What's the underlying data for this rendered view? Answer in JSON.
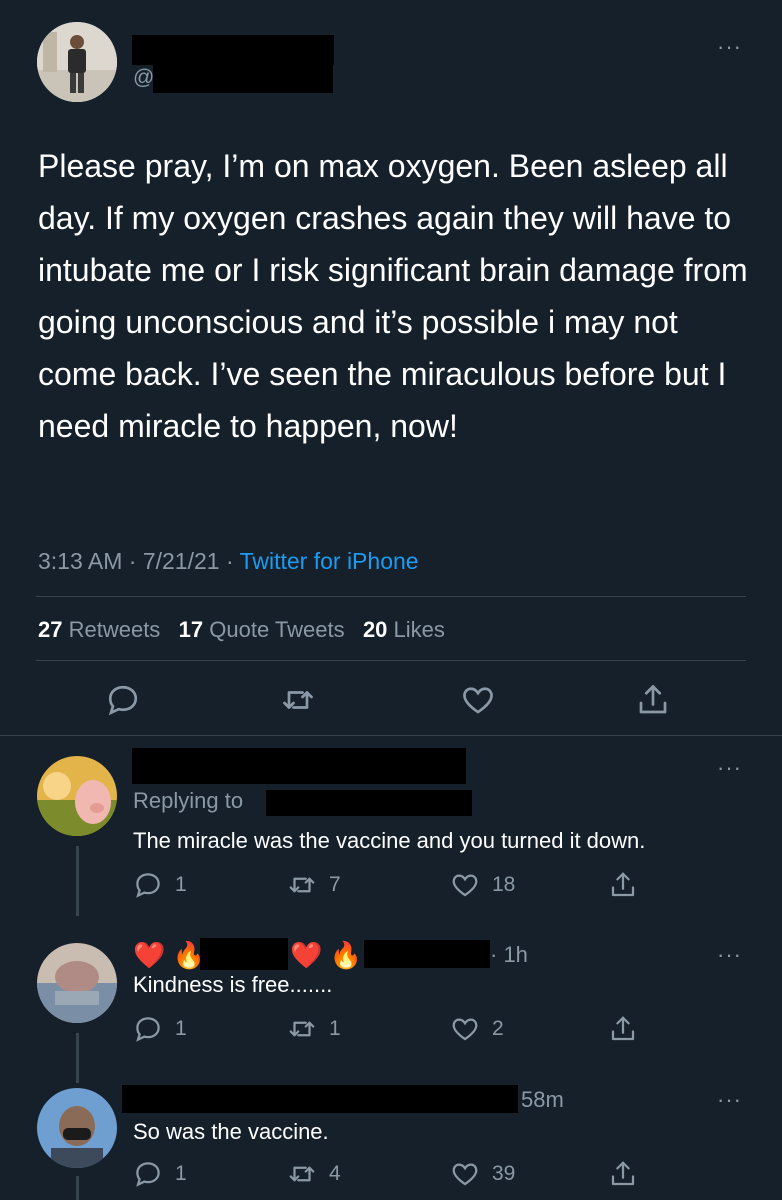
{
  "main_tweet": {
    "handle_prefix": "@",
    "text": "Please pray, I’m on max oxygen. Been asleep all day. If my oxygen crashes again they will have to intubate me or I risk significant brain damage from going unconscious and it’s possible i may not come back. I’ve seen the miraculous before but I need miracle to happen, now!",
    "time": "3:13 AM · 7/21/21 · ",
    "source": "Twitter for iPhone",
    "stats": {
      "retweets_count": "27",
      "retweets_label": " Retweets",
      "quotes_count": "17",
      "quotes_label": " Quote Tweets",
      "likes_count": "20",
      "likes_label": " Likes"
    },
    "more": "···"
  },
  "replies": [
    {
      "replying_to": "Replying to ",
      "text": "The miracle was the vaccine and you turned it down.",
      "replies": "1",
      "retweets": "7",
      "likes": "18",
      "more": "···"
    },
    {
      "name_emoji": "❤️",
      "time": "· 1h",
      "text": "Kindness is free.......",
      "replies": "1",
      "retweets": "1",
      "likes": "2",
      "more": "···"
    },
    {
      "time": "58m",
      "text": "So was the vaccine.",
      "replies": "1",
      "retweets": "4",
      "likes": "39",
      "more": "···"
    }
  ],
  "colors": {
    "background": "#15202b",
    "muted": "#8b98a5",
    "link": "#1d9bf0",
    "divider": "#38444d"
  }
}
